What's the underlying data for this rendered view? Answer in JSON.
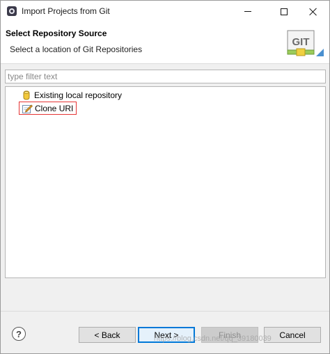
{
  "window": {
    "title": "Import Projects from Git"
  },
  "banner": {
    "title": "Select Repository Source",
    "subtitle": "Select a location of Git Repositories",
    "logo_text": "GIT"
  },
  "filter": {
    "placeholder": "type filter text",
    "value": ""
  },
  "tree": {
    "items": [
      {
        "label": "Existing local repository",
        "icon": "repository-cylinder-icon",
        "selected": false
      },
      {
        "label": "Clone URI",
        "icon": "edit-uri-icon",
        "selected": true,
        "highlight_color": "#e53333"
      }
    ]
  },
  "buttons": {
    "help": "?",
    "back": "< Back",
    "next": "Next >",
    "finish": "Finish",
    "cancel": "Cancel"
  },
  "watermark": "https://blog.csdn.net/qq_39180039",
  "colors": {
    "accent": "#0078d7",
    "highlight": "#e53333"
  }
}
